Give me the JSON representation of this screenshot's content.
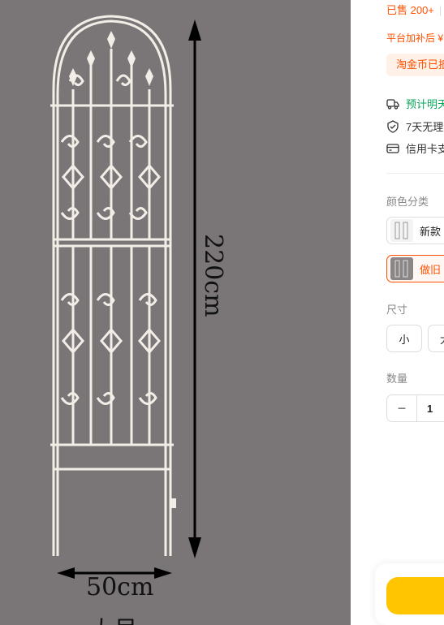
{
  "image": {
    "height_label": "220cm",
    "width_label": "50cm",
    "size_caption": "大号"
  },
  "info": {
    "sold": "已售 200+",
    "sold_sep": "|",
    "subsidy": "平台加补后 ¥",
    "coin": "淘金币已抵"
  },
  "services": {
    "delivery": "预计明天",
    "return": "7天无理",
    "credit": "信用卡支"
  },
  "color": {
    "label": "颜色分类",
    "options": [
      "新款",
      "做旧"
    ]
  },
  "size": {
    "label": "尺寸",
    "options": [
      "小",
      "大"
    ]
  },
  "quantity": {
    "label": "数量",
    "minus": "−",
    "value": "1"
  },
  "colors": {
    "accent": "#ff5000",
    "green": "#0aa55a",
    "buy": "#ffc500"
  }
}
